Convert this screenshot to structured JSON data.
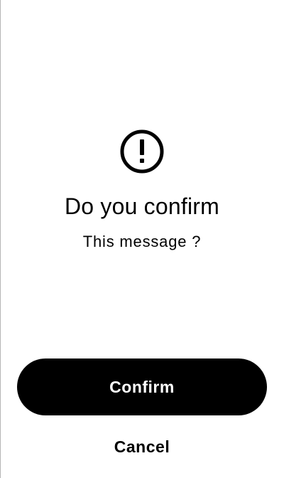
{
  "dialog": {
    "icon": "exclamation-circle-icon",
    "title": "Do you confirm",
    "message": "This message ?"
  },
  "actions": {
    "confirm_label": "Confirm",
    "cancel_label": "Cancel"
  },
  "colors": {
    "background": "#ffffff",
    "primary": "#000000",
    "primary_text": "#ffffff",
    "border": "#b5b5b5"
  }
}
